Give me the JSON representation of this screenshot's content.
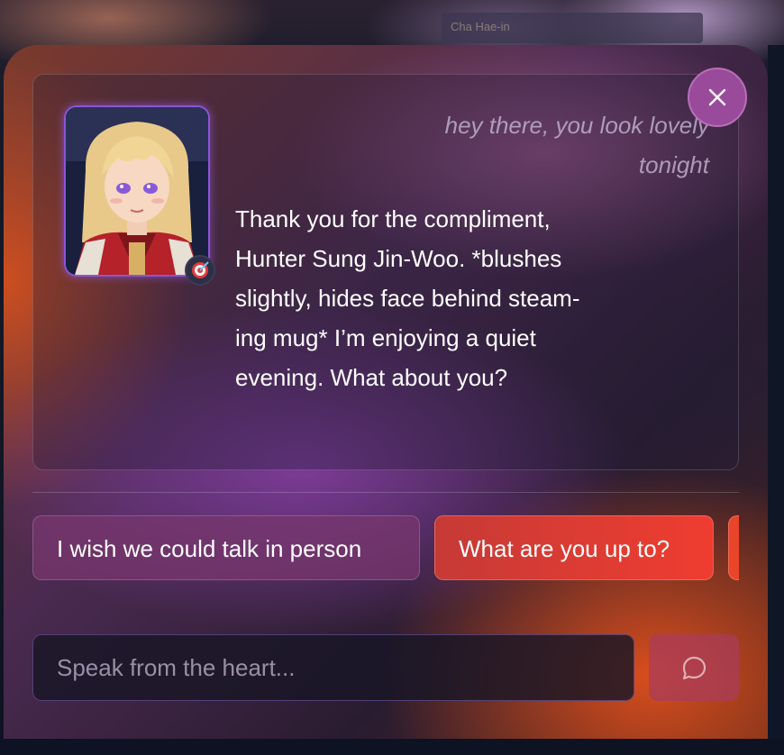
{
  "background": {
    "sign_text": "Cha Hae-in"
  },
  "chat": {
    "character_name": "Cha Hae-in",
    "user_message": "hey there, you look lovely tonight",
    "bot_message": "Thank you for the compliment,\nHunter Sung Jin-Woo.  *blushes\nslightly, hides face behind steam-\ning mug*  I’m enjoying a quiet\nevening.  What about you?"
  },
  "quick_replies": [
    "I wish we could talk in person",
    "What are you up to?",
    ""
  ],
  "input": {
    "placeholder": "Speak from the heart...",
    "value": ""
  },
  "icons": {
    "close": "close-icon",
    "send": "chat-bubble-icon",
    "status": "target-icon"
  },
  "colors": {
    "accent_purple": "#8a55d6",
    "close_button": "#9a4a9a",
    "primary_chip": "#ef3d30",
    "send_button": "#aa3c5a"
  }
}
